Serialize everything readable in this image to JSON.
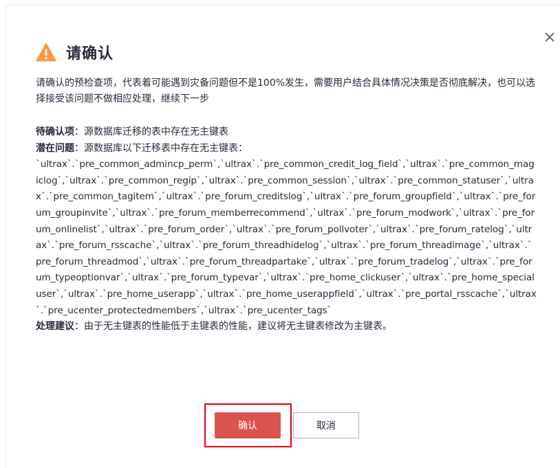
{
  "dialog": {
    "title": "请确认",
    "description": "请确认的预检查项，代表着可能遇到灾备问题但不是100%发生，需要用户结合具体情况决策是否彻底解决，也可以选择接受该问题不做相应处理，继续下一步",
    "pending_label": "待确认项",
    "pending_value": "：源数据库迁移的表中存在无主键表",
    "issue_label": "潜在问题",
    "issue_value": "：源数据库以下迁移表中存在无主键表：",
    "tables_text": "`ultrax`.`pre_common_admincp_perm`,`ultrax`.`pre_common_credit_log_field`,`ultrax`.`pre_common_magiclog`,`ultrax`.`pre_common_regip`,`ultrax`.`pre_common_session`,`ultrax`.`pre_common_statuser`,`ultrax`.`pre_common_tagitem`,`ultrax`.`pre_forum_creditslog`,`ultrax`.`pre_forum_groupfield`,`ultrax`.`pre_forum_groupinvite`,`ultrax`.`pre_forum_memberrecommend`,`ultrax`.`pre_forum_modwork`,`ultrax`.`pre_forum_onlinelist`,`ultrax`.`pre_forum_order`,`ultrax`.`pre_forum_pollvoter`,`ultrax`.`pre_forum_ratelog`,`ultrax`.`pre_forum_rsscache`,`ultrax`.`pre_forum_threadhidelog`,`ultrax`.`pre_forum_threadimage`,`ultrax`.`pre_forum_threadmod`,`ultrax`.`pre_forum_threadpartake`,`ultrax`.`pre_forum_tradelog`,`ultrax`.`pre_forum_typeoptionvar`,`ultrax`.`pre_forum_typevar`,`ultrax`.`pre_home_clickuser`,`ultrax`.`pre_home_specialuser`,`ultrax`.`pre_home_userapp`,`ultrax`.`pre_home_userappfield`,`ultrax`.`pre_portal_rsscache`,`ultrax`.`pre_ucenter_protectedmembers`,`ultrax`.`pre_ucenter_tags`",
    "suggestion_label": "处理建议",
    "suggestion_value": "：由于无主键表的性能低于主键表的性能，建议将无主键表修改为主键表。",
    "confirm_label": "确认",
    "cancel_label": "取消"
  },
  "icons": {
    "warning": "warning-icon",
    "close": "close-icon"
  },
  "colors": {
    "warning": "#fa9841",
    "confirm_button": "#d9534f",
    "highlight_border": "#e60012",
    "text": "#252b3a"
  }
}
